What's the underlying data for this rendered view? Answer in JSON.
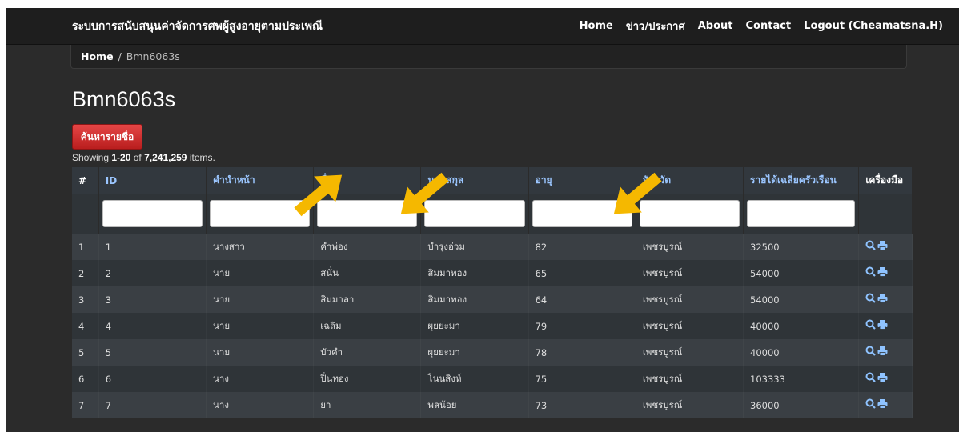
{
  "navbar": {
    "brand": "ระบบการสนับสนุนค่าจัดการศพผู้สูงอายุตามประเพณี",
    "links": [
      "Home",
      "ข่าว/ประกาศ",
      "About",
      "Contact",
      "Logout (Cheamatsna.H)"
    ]
  },
  "breadcrumb": {
    "home": "Home",
    "separator": "/",
    "current": "Bmn6063s"
  },
  "page": {
    "title": "Bmn6063s",
    "search_button": "ค้นหารายชื่อ",
    "summary_prefix": "Showing ",
    "summary_range": "1-20",
    "summary_of": " of ",
    "summary_total": "7,241,259",
    "summary_suffix": " items."
  },
  "table": {
    "headers": [
      "#",
      "ID",
      "คำนำหน้า",
      "ชื่อ",
      "นามสกุล",
      "อายุ",
      "จังหวัด",
      "รายได้เฉลี่ยครัวเรือน",
      "เครื่องมือ"
    ],
    "rows": [
      [
        "1",
        "1",
        "นางสาว",
        "คำพ่อง",
        "บำรุงอ่วม",
        "82",
        "เพชรบูรณ์",
        "32500"
      ],
      [
        "2",
        "2",
        "นาย",
        "สนั่น",
        "สิมมาทอง",
        "65",
        "เพชรบูรณ์",
        "54000"
      ],
      [
        "3",
        "3",
        "นาย",
        "สิมมาลา",
        "สิมมาทอง",
        "64",
        "เพชรบูรณ์",
        "54000"
      ],
      [
        "4",
        "4",
        "นาย",
        "เฉลิม",
        "ผุยยะมา",
        "79",
        "เพชรบูรณ์",
        "40000"
      ],
      [
        "5",
        "5",
        "นาย",
        "บัวคำ",
        "ผุยยะมา",
        "78",
        "เพชรบูรณ์",
        "40000"
      ],
      [
        "6",
        "6",
        "นาง",
        "ปิ่นทอง",
        "โนนสิงห์",
        "75",
        "เพชรบูรณ์",
        "103333"
      ],
      [
        "7",
        "7",
        "นาง",
        "ยา",
        "พลน้อย",
        "73",
        "เพชรบูรณ์",
        "36000"
      ]
    ],
    "tool_icons": [
      "search-icon",
      "print-icon"
    ]
  },
  "colors": {
    "background": "#2b2b2b",
    "navbar": "#1e1e1e",
    "header_text": "#9bc6ff",
    "search_button": "#d32f2f",
    "annotation_arrow": "#f5b800"
  }
}
